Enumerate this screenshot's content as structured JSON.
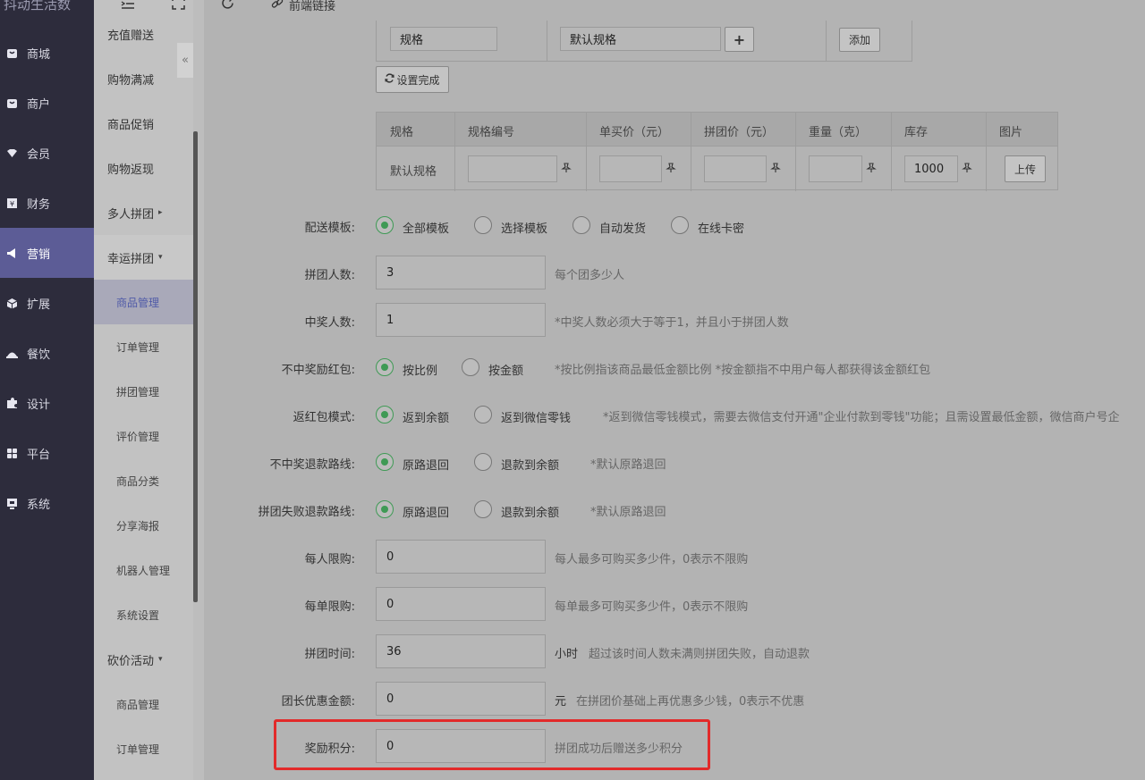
{
  "nav": {
    "brand": "抖动生活数",
    "items": [
      {
        "label": "商城",
        "icon": "shop-icon"
      },
      {
        "label": "商户",
        "icon": "store-icon"
      },
      {
        "label": "会员",
        "icon": "member-icon"
      },
      {
        "label": "财务",
        "icon": "finance-icon"
      },
      {
        "label": "营销",
        "icon": "megaphone-icon"
      },
      {
        "label": "扩展",
        "icon": "cube-icon"
      },
      {
        "label": "餐饮",
        "icon": "dining-icon"
      },
      {
        "label": "设计",
        "icon": "puzzle-icon"
      },
      {
        "label": "平台",
        "icon": "grid-icon"
      },
      {
        "label": "系统",
        "icon": "system-icon"
      }
    ],
    "active_index": 4
  },
  "submenu": {
    "items": [
      {
        "label": "充值赠送",
        "level": 1
      },
      {
        "label": "购物满减",
        "level": 1
      },
      {
        "label": "商品促销",
        "level": 1
      },
      {
        "label": "购物返现",
        "level": 1
      },
      {
        "label": "多人拼团",
        "level": 1,
        "caret": "▸"
      },
      {
        "label": "幸运拼团",
        "level": 1,
        "caret": "▾",
        "open": true
      },
      {
        "label": "商品管理",
        "level": 2,
        "active": true
      },
      {
        "label": "订单管理",
        "level": 2
      },
      {
        "label": "拼团管理",
        "level": 2
      },
      {
        "label": "评价管理",
        "level": 2
      },
      {
        "label": "商品分类",
        "level": 2
      },
      {
        "label": "分享海报",
        "level": 2
      },
      {
        "label": "机器人管理",
        "level": 2
      },
      {
        "label": "系统设置",
        "level": 2
      },
      {
        "label": "砍价活动",
        "level": 1,
        "caret": "▾"
      },
      {
        "label": "商品管理",
        "level": 2
      },
      {
        "label": "订单管理",
        "level": 2
      }
    ],
    "collapse_glyph": "«"
  },
  "toolbar": {
    "link_label": "前端链接"
  },
  "spec_setup": {
    "spec_name": "规格",
    "spec_value": "默认规格",
    "add_glyph": "+",
    "add_label": "添加",
    "done_label": "设置完成"
  },
  "spec_table": {
    "headers": [
      "规格",
      "规格编号",
      "单买价（元）",
      "拼团价（元）",
      "重量（克）",
      "库存",
      "图片"
    ],
    "row": {
      "spec": "默认规格",
      "code": "",
      "single_price": "",
      "group_price": "",
      "weight": "",
      "stock": "1000",
      "upload_label": "上传"
    }
  },
  "form": {
    "shipping": {
      "label": "配送模板:",
      "options": [
        "全部模板",
        "选择模板",
        "自动发货",
        "在线卡密"
      ],
      "selected": 0
    },
    "group_size": {
      "label": "拼团人数:",
      "value": "3",
      "hint": "每个团多少人"
    },
    "winners": {
      "label": "中奖人数:",
      "value": "1",
      "hint": "*中奖人数必须大于等于1，并且小于拼团人数"
    },
    "consolation": {
      "label": "不中奖励红包:",
      "options": [
        "按比例",
        "按金额"
      ],
      "selected": 0,
      "hint": "*按比例指该商品最低金额比例   *按金额指不中用户每人都获得该金额红包"
    },
    "refund_mode": {
      "label": "返红包模式:",
      "options": [
        "返到余额",
        "返到微信零钱"
      ],
      "selected": 0,
      "hint": "*返到微信零钱模式，需要去微信支付开通\"企业付款到零钱\"功能；且需设置最低金额，微信商户号企"
    },
    "loser_refund": {
      "label": "不中奖退款路线:",
      "options": [
        "原路退回",
        "退款到余额"
      ],
      "selected": 0,
      "hint": "*默认原路退回"
    },
    "fail_refund": {
      "label": "拼团失败退款路线:",
      "options": [
        "原路退回",
        "退款到余额"
      ],
      "selected": 0,
      "hint": "*默认原路退回"
    },
    "per_person_limit": {
      "label": "每人限购:",
      "value": "0",
      "hint": "每人最多可购买多少件，0表示不限购"
    },
    "per_order_limit": {
      "label": "每单限购:",
      "value": "0",
      "hint": "每单最多可购买多少件，0表示不限购"
    },
    "group_time": {
      "label": "拼团时间:",
      "value": "36",
      "unit": "小时",
      "hint": "超过该时间人数未满则拼团失败，自动退款"
    },
    "leader_discount": {
      "label": "团长优惠金额:",
      "value": "0",
      "unit": "元",
      "hint": "在拼团价基础上再优惠多少钱，0表示不优惠"
    },
    "reward_points": {
      "label": "奖励积分:",
      "value": "0",
      "hint": "拼团成功后赠送多少积分"
    }
  },
  "colors": {
    "nav_bg": "#2d2c3c",
    "nav_active": "#5c5c96",
    "radio_checked": "#3f9a55",
    "highlight_box": "#e22a2a"
  }
}
